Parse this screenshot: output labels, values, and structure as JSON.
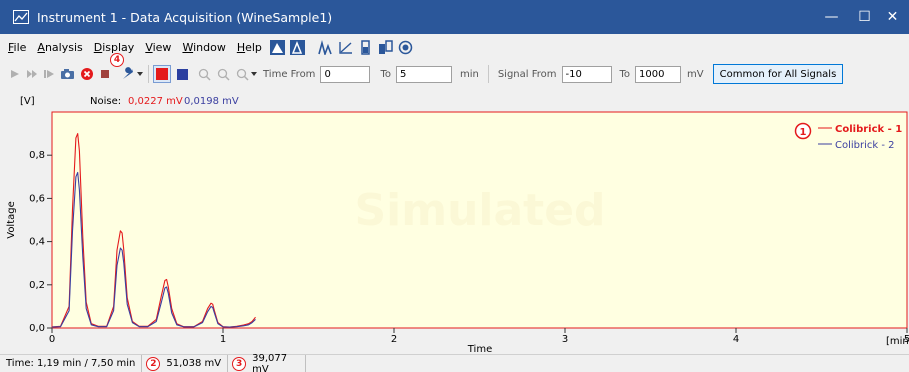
{
  "window": {
    "title": "Instrument 1 - Data Acquisition (WineSample1)",
    "minimize_glyph": "—",
    "maximize_glyph": "☐",
    "close_glyph": "✕"
  },
  "menu": {
    "items": [
      {
        "label": "File",
        "underline": "F",
        "rest": "ile"
      },
      {
        "label": "Analysis",
        "underline": "A",
        "rest": "nalysis"
      },
      {
        "label": "Display",
        "underline": "D",
        "rest": "isplay"
      },
      {
        "label": "View",
        "underline": "V",
        "rest": "iew"
      },
      {
        "label": "Window",
        "underline": "W",
        "rest": "indow"
      },
      {
        "label": "Help",
        "underline": "H",
        "rest": "elp"
      }
    ]
  },
  "toolbar": {
    "time_from_label": "Time From",
    "time_from_value": "0",
    "time_to_label": "To",
    "time_to_value": "5",
    "time_unit": "min",
    "signal_from_label": "Signal From",
    "signal_from_value": "-10",
    "signal_to_label": "To",
    "signal_to_value": "1000",
    "signal_unit": "mV",
    "common_button": "Common for All Signals"
  },
  "noise": {
    "label": "Noise:",
    "value1": "0,0227 mV",
    "value2": "0,0198 mV"
  },
  "annotations": {
    "badge1": "1",
    "badge2": "2",
    "badge3": "3",
    "badge4": "4"
  },
  "watermark": "Simulated",
  "status": {
    "time": "Time: 1,19 min / 7,50 min",
    "signal1": "51,038 mV",
    "signal2": "39,077 mV"
  },
  "colors": {
    "titlebar": "#2b579a",
    "plot_bg": "#ffffe1",
    "series1": "#e41a1c",
    "series2": "#3b3fa0"
  },
  "chart_data": {
    "type": "line",
    "ylabel": "Voltage",
    "yunit": "[V]",
    "xlabel": "Time",
    "xunit": "[min]",
    "xlim": [
      0,
      5
    ],
    "ylim": [
      0,
      1.0
    ],
    "xticks": [
      0,
      1,
      2,
      3,
      4,
      5
    ],
    "yticks": [
      0.0,
      0.2,
      0.4,
      0.6,
      0.8
    ],
    "ytick_labels": [
      "0,0",
      "0,2",
      "0,4",
      "0,6",
      "0,8"
    ],
    "legend_position": "top-right",
    "series": [
      {
        "name": "Colibrick - 1",
        "color": "#e41a1c",
        "x": [
          0.0,
          0.05,
          0.1,
          0.12,
          0.14,
          0.15,
          0.16,
          0.18,
          0.2,
          0.23,
          0.27,
          0.32,
          0.36,
          0.38,
          0.4,
          0.41,
          0.42,
          0.44,
          0.47,
          0.51,
          0.56,
          0.61,
          0.64,
          0.66,
          0.67,
          0.68,
          0.7,
          0.73,
          0.77,
          0.83,
          0.88,
          0.91,
          0.93,
          0.94,
          0.95,
          0.97,
          1.0,
          1.04,
          1.08,
          1.12,
          1.15,
          1.17,
          1.19
        ],
        "y": [
          0.005,
          0.008,
          0.1,
          0.55,
          0.88,
          0.9,
          0.82,
          0.42,
          0.12,
          0.02,
          0.008,
          0.008,
          0.1,
          0.36,
          0.45,
          0.44,
          0.36,
          0.14,
          0.03,
          0.008,
          0.008,
          0.04,
          0.15,
          0.22,
          0.225,
          0.19,
          0.09,
          0.02,
          0.006,
          0.006,
          0.03,
          0.09,
          0.115,
          0.11,
          0.08,
          0.025,
          0.006,
          0.004,
          0.008,
          0.014,
          0.02,
          0.03,
          0.05
        ]
      },
      {
        "name": "Colibrick - 2",
        "color": "#3b3fa0",
        "x": [
          0.0,
          0.05,
          0.1,
          0.12,
          0.14,
          0.15,
          0.16,
          0.18,
          0.2,
          0.23,
          0.27,
          0.32,
          0.36,
          0.38,
          0.4,
          0.41,
          0.42,
          0.44,
          0.47,
          0.51,
          0.56,
          0.61,
          0.64,
          0.66,
          0.67,
          0.68,
          0.7,
          0.73,
          0.77,
          0.83,
          0.88,
          0.91,
          0.93,
          0.94,
          0.95,
          0.97,
          1.0,
          1.04,
          1.08,
          1.12,
          1.15,
          1.17,
          1.19
        ],
        "y": [
          0.004,
          0.006,
          0.08,
          0.45,
          0.7,
          0.72,
          0.64,
          0.33,
          0.09,
          0.015,
          0.006,
          0.006,
          0.08,
          0.29,
          0.37,
          0.36,
          0.3,
          0.11,
          0.025,
          0.006,
          0.006,
          0.03,
          0.12,
          0.185,
          0.19,
          0.16,
          0.07,
          0.015,
          0.005,
          0.005,
          0.025,
          0.075,
          0.1,
          0.095,
          0.07,
          0.02,
          0.005,
          0.004,
          0.006,
          0.01,
          0.015,
          0.025,
          0.04
        ]
      }
    ]
  }
}
